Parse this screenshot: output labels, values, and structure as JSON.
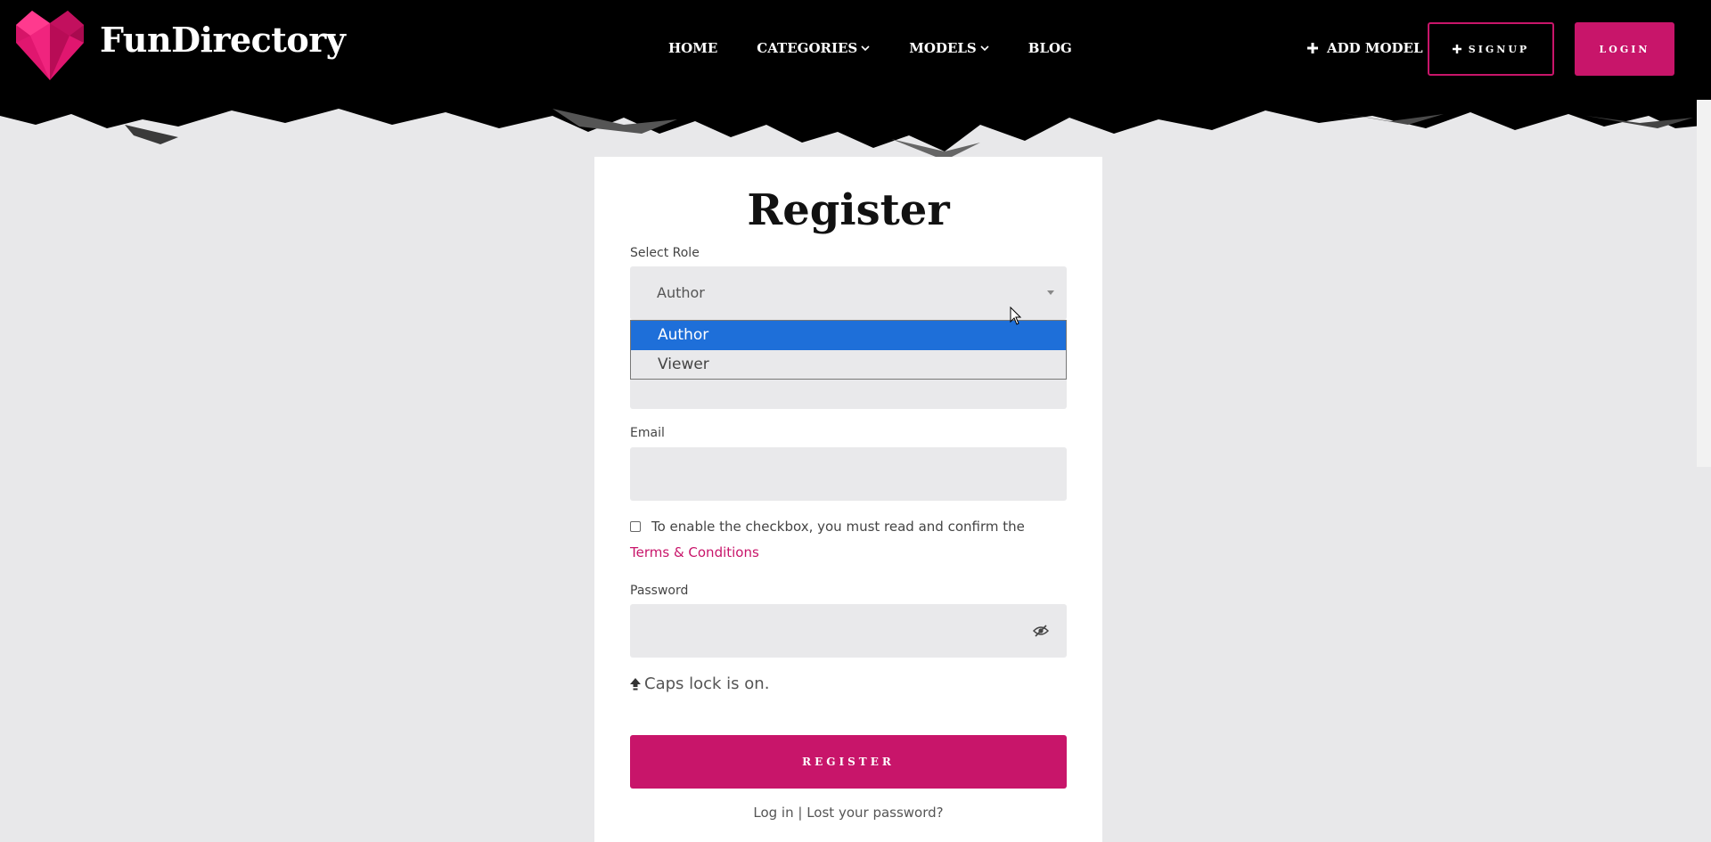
{
  "brand": {
    "name": "FunDirectory",
    "accent": "#c8156a"
  },
  "nav": [
    {
      "label": "HOME",
      "has_dropdown": false
    },
    {
      "label": "CATEGORIES",
      "has_dropdown": true
    },
    {
      "label": "MODELS",
      "has_dropdown": true
    },
    {
      "label": "BLOG",
      "has_dropdown": false
    }
  ],
  "header_actions": {
    "add_model": "ADD MODEL",
    "signup": "SIGNUP",
    "login": "LOGIN"
  },
  "form": {
    "title": "Register",
    "role_label": "Select Role",
    "role_value": "Author",
    "role_options": [
      "Author",
      "Viewer"
    ],
    "role_selected_index": 0,
    "email_label": "Email",
    "email_value": "",
    "terms_checkbox_text": "To enable the checkbox, you must read and confirm the",
    "terms_link": "Terms & Conditions",
    "password_label": "Password",
    "password_value": "",
    "caps_lock_text": "Caps lock is on.",
    "register_button": "REGISTER",
    "login_link": "Log in",
    "separator": "|",
    "lost_password_link": "Lost your password?"
  }
}
